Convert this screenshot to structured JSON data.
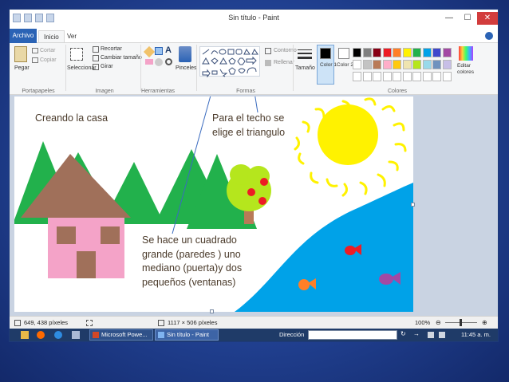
{
  "window": {
    "title": "Sin título - Paint",
    "controls": {
      "minimize": "—",
      "maximize": "☐",
      "close": "✕"
    }
  },
  "tabs": [
    {
      "label": "Archivo"
    },
    {
      "label": "Inicio"
    },
    {
      "label": "Ver"
    }
  ],
  "ribbon": {
    "clipboard": {
      "paste": "Pegar",
      "cut": "Cortar",
      "copy": "Copiar",
      "group": "Portapapeles"
    },
    "image": {
      "select": "Seleccionar",
      "crop": "Recortar",
      "resize": "Cambiar tamaño",
      "rotate": "Girar",
      "group": "Imagen"
    },
    "tools": {
      "group": "Herramientas",
      "text_tool": "A"
    },
    "brushes": {
      "label": "Pinceles"
    },
    "shapes": {
      "outline": "Contorno",
      "fill": "Rellenar",
      "group": "Formas"
    },
    "size": {
      "label": "Tamaño"
    },
    "colors": {
      "color1": "Color 1",
      "color2": "Color 2",
      "edit": "Editar colores",
      "group": "Colores",
      "palette_row1": [
        "#000000",
        "#7f7f7f",
        "#880015",
        "#ed1c24",
        "#ff7f27",
        "#fff200",
        "#22b14c",
        "#00a2e8",
        "#3f48cc",
        "#a349a4"
      ],
      "palette_row2": [
        "#ffffff",
        "#c3c3c3",
        "#b97a57",
        "#ffaec9",
        "#ffc90e",
        "#efe4b0",
        "#b5e61d",
        "#99d9ea",
        "#7092be",
        "#c8bfe7"
      ],
      "color1_value": "#000000",
      "color2_value": "#ffffff"
    }
  },
  "annotations": {
    "title_note": "Creando la casa",
    "roof_note": [
      "Para el techo se",
      "elige el triangulo"
    ],
    "walls_note": [
      "Se hace un cuadrado",
      "grande (paredes ) uno",
      "mediano (puerta)y dos",
      "pequeños (ventanas)"
    ]
  },
  "status": {
    "cursor": "649, 438 píxeles",
    "canvas_size": "1117 × 506 píxeles",
    "zoom": "100%"
  },
  "taskbar": {
    "app1": "Microsoft Powe...",
    "app2": "Sin título - Paint",
    "address_label": "Dirección",
    "clock": "11:45 a. m."
  },
  "colors": {
    "tree_green": "#22b14c",
    "roof_brown": "#a0705a",
    "wall_pink": "#f4a3c8",
    "sun_yellow": "#fff200",
    "sea_blue": "#00a2e8",
    "apple_red": "#ed1c24"
  }
}
